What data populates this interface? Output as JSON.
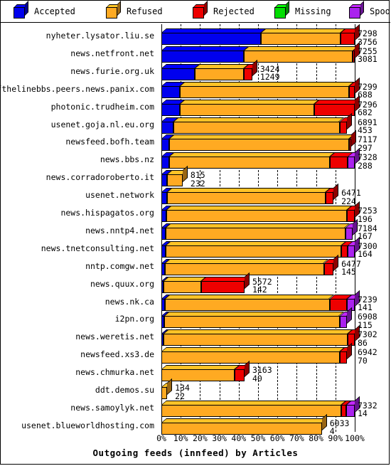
{
  "legend": {
    "items": [
      {
        "label": "Accepted",
        "color": "#0000ee",
        "icon": "cube-icon"
      },
      {
        "label": "Refused",
        "color": "#ffaa22",
        "icon": "cube-icon"
      },
      {
        "label": "Rejected",
        "color": "#ee0000",
        "icon": "cube-icon"
      },
      {
        "label": "Missing",
        "color": "#00dd00",
        "icon": "cube-icon"
      },
      {
        "label": "Spooled",
        "color": "#aa22ee",
        "icon": "cube-icon"
      }
    ]
  },
  "chart_data": {
    "type": "bar",
    "orientation": "horizontal",
    "stacked": true,
    "percent_stacked": true,
    "title": "Outgoing feeds (innfeed) by Articles",
    "xlabel": "",
    "ylabel": "",
    "xlim": [
      0,
      100
    ],
    "xticks": [
      "0%",
      "10%",
      "20%",
      "30%",
      "40%",
      "50%",
      "60%",
      "70%",
      "80%",
      "90%",
      "100%"
    ],
    "grid": true,
    "legend_position": "top",
    "series_names": [
      "Accepted",
      "Refused",
      "Rejected",
      "Missing",
      "Spooled"
    ],
    "series_colors": [
      "#0000ee",
      "#ffaa22",
      "#ee0000",
      "#00dd00",
      "#aa22ee"
    ],
    "categories": [
      "nyheter.lysator.liu.se",
      "news.netfront.net",
      "news.furie.org.uk",
      "endofthelinebbs.peers.news.panix.com",
      "photonic.trudheim.com",
      "usenet.goja.nl.eu.org",
      "newsfeed.bofh.team",
      "news.bbs.nz",
      "news.corradoroberto.it",
      "usenet.network",
      "news.hispagatos.org",
      "news.nntp4.net",
      "news.tnetconsulting.net",
      "nntp.comgw.net",
      "news.quux.org",
      "news.nk.ca",
      "i2pn.org",
      "news.weretis.net",
      "newsfeed.xs3.de",
      "news.chmurka.net",
      "ddt.demos.su",
      "news.samoylyk.net",
      "usenet.blueworldhosting.com"
    ],
    "rows": [
      {
        "label": "nyheter.lysator.liu.se",
        "total": 7298,
        "value2": 3756,
        "bar_pct": 100,
        "segments": [
          {
            "name": "Accepted",
            "pct": 51.5
          },
          {
            "name": "Refused",
            "pct": 41.0
          },
          {
            "name": "Rejected",
            "pct": 7.5
          }
        ],
        "label_inside": false
      },
      {
        "label": "news.netfront.net",
        "total": 7255,
        "value2": 3081,
        "bar_pct": 100,
        "segments": [
          {
            "name": "Accepted",
            "pct": 42.5
          },
          {
            "name": "Refused",
            "pct": 56.5
          },
          {
            "name": "Rejected",
            "pct": 1.0
          }
        ],
        "label_inside": false
      },
      {
        "label": "news.furie.org.uk",
        "total": 3424,
        "value2": 1249,
        "bar_pct": 47,
        "segments": [
          {
            "name": "Accepted",
            "pct": 36.5
          },
          {
            "name": "Refused",
            "pct": 54.0
          },
          {
            "name": "Rejected",
            "pct": 9.5
          }
        ],
        "label_inside": true
      },
      {
        "label": "endofthelinebbs.peers.news.panix.com",
        "total": 7299,
        "value2": 688,
        "bar_pct": 100,
        "segments": [
          {
            "name": "Accepted",
            "pct": 9.4
          },
          {
            "name": "Refused",
            "pct": 87.6
          },
          {
            "name": "Rejected",
            "pct": 3.0
          }
        ],
        "label_inside": false
      },
      {
        "label": "photonic.trudheim.com",
        "total": 7296,
        "value2": 682,
        "bar_pct": 100,
        "segments": [
          {
            "name": "Accepted",
            "pct": 9.4
          },
          {
            "name": "Refused",
            "pct": 69.6
          },
          {
            "name": "Rejected",
            "pct": 21.0
          }
        ],
        "label_inside": false
      },
      {
        "label": "usenet.goja.nl.eu.org",
        "total": 6891,
        "value2": 453,
        "bar_pct": 96,
        "segments": [
          {
            "name": "Accepted",
            "pct": 6.6
          },
          {
            "name": "Refused",
            "pct": 89.4
          },
          {
            "name": "Rejected",
            "pct": 4.0
          }
        ],
        "label_inside": false
      },
      {
        "label": "newsfeed.bofh.team",
        "total": 7117,
        "value2": 297,
        "bar_pct": 98,
        "segments": [
          {
            "name": "Accepted",
            "pct": 4.2
          },
          {
            "name": "Refused",
            "pct": 95.0
          },
          {
            "name": "Rejected",
            "pct": 0.8
          }
        ],
        "label_inside": false
      },
      {
        "label": "news.bbs.nz",
        "total": 7328,
        "value2": 288,
        "bar_pct": 100,
        "segments": [
          {
            "name": "Accepted",
            "pct": 3.9
          },
          {
            "name": "Refused",
            "pct": 83.1
          },
          {
            "name": "Rejected",
            "pct": 9.5
          },
          {
            "name": "Spooled",
            "pct": 3.5
          }
        ],
        "label_inside": false
      },
      {
        "label": "news.corradoroberto.it",
        "total": 815,
        "value2": 232,
        "bar_pct": 11,
        "segments": [
          {
            "name": "Accepted",
            "pct": 28.0
          },
          {
            "name": "Refused",
            "pct": 72.0
          }
        ],
        "label_inside": true
      },
      {
        "label": "usenet.network",
        "total": 6471,
        "value2": 224,
        "bar_pct": 89,
        "segments": [
          {
            "name": "Accepted",
            "pct": 3.5
          },
          {
            "name": "Refused",
            "pct": 92.0
          },
          {
            "name": "Rejected",
            "pct": 4.5
          }
        ],
        "label_inside": true
      },
      {
        "label": "news.hispagatos.org",
        "total": 7253,
        "value2": 196,
        "bar_pct": 100,
        "segments": [
          {
            "name": "Accepted",
            "pct": 2.7
          },
          {
            "name": "Refused",
            "pct": 93.3
          },
          {
            "name": "Rejected",
            "pct": 4.0
          }
        ],
        "label_inside": false
      },
      {
        "label": "news.nntp4.net",
        "total": 7184,
        "value2": 167,
        "bar_pct": 99,
        "segments": [
          {
            "name": "Accepted",
            "pct": 2.3
          },
          {
            "name": "Refused",
            "pct": 93.7
          },
          {
            "name": "Spooled",
            "pct": 4.0
          }
        ],
        "label_inside": false
      },
      {
        "label": "news.tnetconsulting.net",
        "total": 7300,
        "value2": 164,
        "bar_pct": 100,
        "segments": [
          {
            "name": "Accepted",
            "pct": 2.2
          },
          {
            "name": "Refused",
            "pct": 90.8
          },
          {
            "name": "Rejected",
            "pct": 3.5
          },
          {
            "name": "Spooled",
            "pct": 3.5
          }
        ],
        "label_inside": false
      },
      {
        "label": "nntp.comgw.net",
        "total": 6477,
        "value2": 145,
        "bar_pct": 89,
        "segments": [
          {
            "name": "Accepted",
            "pct": 2.2
          },
          {
            "name": "Refused",
            "pct": 92.3
          },
          {
            "name": "Rejected",
            "pct": 5.5
          }
        ],
        "label_inside": true
      },
      {
        "label": "news.quux.org",
        "total": 5572,
        "value2": 142,
        "bar_pct": 43,
        "segments": [
          {
            "name": "Accepted",
            "pct": 2.5
          },
          {
            "name": "Refused",
            "pct": 45.5
          },
          {
            "name": "Rejected",
            "pct": 52.0
          }
        ],
        "label_inside": true
      },
      {
        "label": "news.nk.ca",
        "total": 7239,
        "value2": 141,
        "bar_pct": 100,
        "segments": [
          {
            "name": "Accepted",
            "pct": 1.9
          },
          {
            "name": "Refused",
            "pct": 85.1
          },
          {
            "name": "Rejected",
            "pct": 9.0
          },
          {
            "name": "Spooled",
            "pct": 4.0
          }
        ],
        "label_inside": false
      },
      {
        "label": "i2pn.org",
        "total": 6908,
        "value2": 115,
        "bar_pct": 96,
        "segments": [
          {
            "name": "Accepted",
            "pct": 1.7
          },
          {
            "name": "Refused",
            "pct": 94.3
          },
          {
            "name": "Spooled",
            "pct": 4.0
          }
        ],
        "label_inside": false
      },
      {
        "label": "news.weretis.net",
        "total": 7302,
        "value2": 86,
        "bar_pct": 100,
        "segments": [
          {
            "name": "Accepted",
            "pct": 1.2
          },
          {
            "name": "Refused",
            "pct": 95.3
          },
          {
            "name": "Rejected",
            "pct": 3.5
          }
        ],
        "label_inside": false
      },
      {
        "label": "newsfeed.xs3.de",
        "total": 6942,
        "value2": 70,
        "bar_pct": 96,
        "segments": [
          {
            "name": "Refused",
            "pct": 96.0
          },
          {
            "name": "Rejected",
            "pct": 4.0
          }
        ],
        "label_inside": false
      },
      {
        "label": "news.chmurka.net",
        "total": 3163,
        "value2": 40,
        "bar_pct": 43,
        "segments": [
          {
            "name": "Refused",
            "pct": 88.0
          },
          {
            "name": "Rejected",
            "pct": 12.0
          }
        ],
        "label_inside": true
      },
      {
        "label": "ddt.demos.su",
        "total": 134,
        "value2": 22,
        "bar_pct": 3,
        "segments": [
          {
            "name": "Refused",
            "pct": 100
          }
        ],
        "label_inside": true
      },
      {
        "label": "news.samoylyk.net",
        "total": 7332,
        "value2": 14,
        "bar_pct": 100,
        "segments": [
          {
            "name": "Refused",
            "pct": 93.0
          },
          {
            "name": "Rejected",
            "pct": 2.5
          },
          {
            "name": "Spooled",
            "pct": 4.5
          }
        ],
        "label_inside": false
      },
      {
        "label": "usenet.blueworldhosting.com",
        "total": 6033,
        "value2": 4,
        "bar_pct": 83,
        "segments": [
          {
            "name": "Refused",
            "pct": 100
          }
        ],
        "label_inside": true
      }
    ]
  }
}
